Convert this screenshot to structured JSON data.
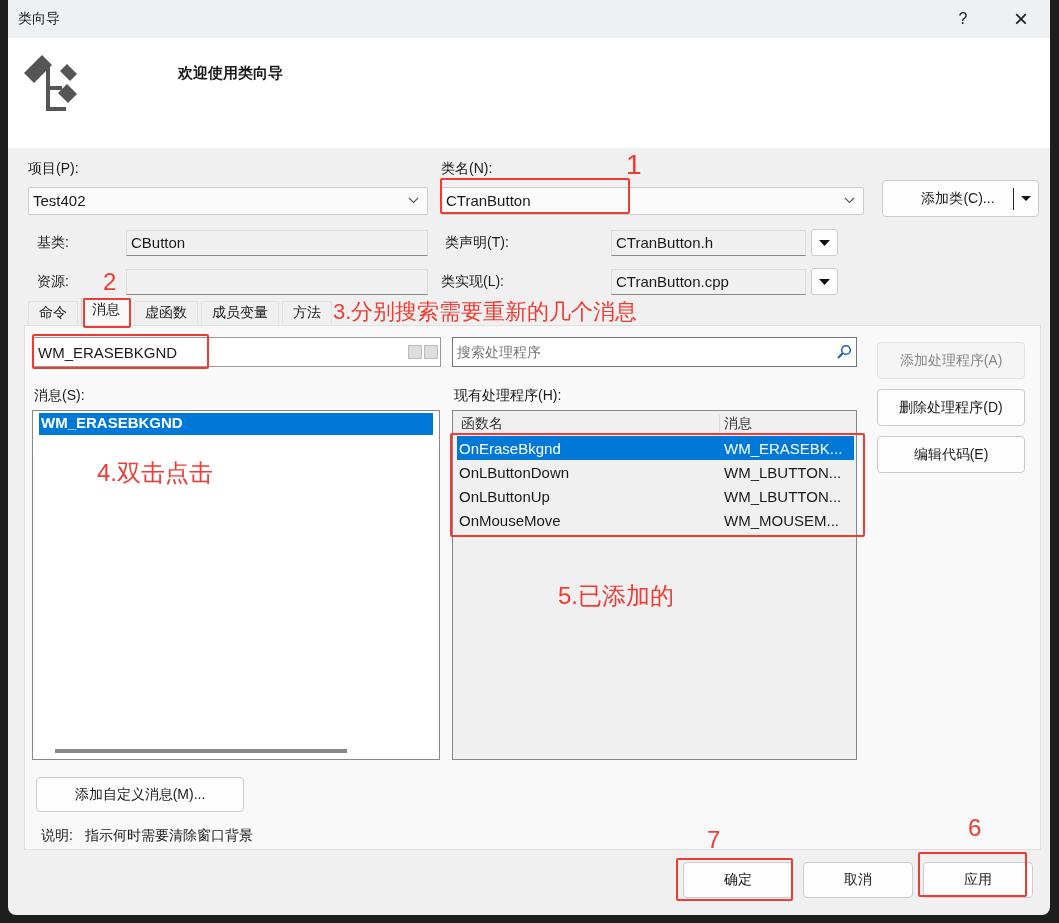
{
  "window": {
    "title": "类向导",
    "help": "?",
    "close": "×"
  },
  "header": {
    "title": "欢迎使用类向导"
  },
  "project": {
    "label": "项目(P):",
    "value": "Test402"
  },
  "class_name": {
    "label": "类名(N):",
    "value": "CTranButton"
  },
  "add_class_button": "添加类(C)...",
  "base_class": {
    "label": "基类:",
    "value": "CButton"
  },
  "resource": {
    "label": "资源:"
  },
  "class_declaration": {
    "label": "类声明(T):",
    "value": "CTranButton.h"
  },
  "class_implementation": {
    "label": "类实现(L):",
    "value": "CTranButton.cpp"
  },
  "tabs": [
    {
      "label": "命令",
      "selected": false
    },
    {
      "label": "消息",
      "selected": true
    },
    {
      "label": "虚函数",
      "selected": false
    },
    {
      "label": "成员变量",
      "selected": false
    },
    {
      "label": "方法",
      "selected": false
    }
  ],
  "message_search": {
    "value": "WM_ERASEBKGND"
  },
  "handler_search": {
    "placeholder": "搜索处理程序"
  },
  "messages": {
    "label": "消息(S):",
    "items": [
      {
        "name": "WM_ERASEBKGND",
        "selected": true
      }
    ]
  },
  "handlers": {
    "label": "现有处理程序(H):",
    "columns": [
      "函数名",
      "消息"
    ],
    "rows": [
      {
        "function": "OnEraseBkgnd",
        "message": "WM_ERASEBK...",
        "selected": true
      },
      {
        "function": "OnLButtonDown",
        "message": "WM_LBUTTON...",
        "selected": false
      },
      {
        "function": "OnLButtonUp",
        "message": "WM_LBUTTON...",
        "selected": false
      },
      {
        "function": "OnMouseMove",
        "message": "WM_MOUSEM...",
        "selected": false
      }
    ]
  },
  "side_buttons": [
    {
      "label": "添加处理程序(A)",
      "disabled": true
    },
    {
      "label": "删除处理程序(D)",
      "disabled": false
    },
    {
      "label": "编辑代码(E)",
      "disabled": false
    }
  ],
  "add_custom_message_button": "添加自定义消息(M)...",
  "description": {
    "label": "说明:",
    "text": "指示何时需要清除窗口背景"
  },
  "footer_buttons": [
    {
      "label": "确定"
    },
    {
      "label": "取消"
    },
    {
      "label": "应用"
    }
  ],
  "annotations": [
    {
      "text": "1"
    },
    {
      "text": "2"
    },
    {
      "text": "3.分别搜索需要重新的几个消息"
    },
    {
      "text": "4.双击点击"
    },
    {
      "text": "5.已添加的"
    },
    {
      "text": "6"
    },
    {
      "text": "7"
    }
  ]
}
